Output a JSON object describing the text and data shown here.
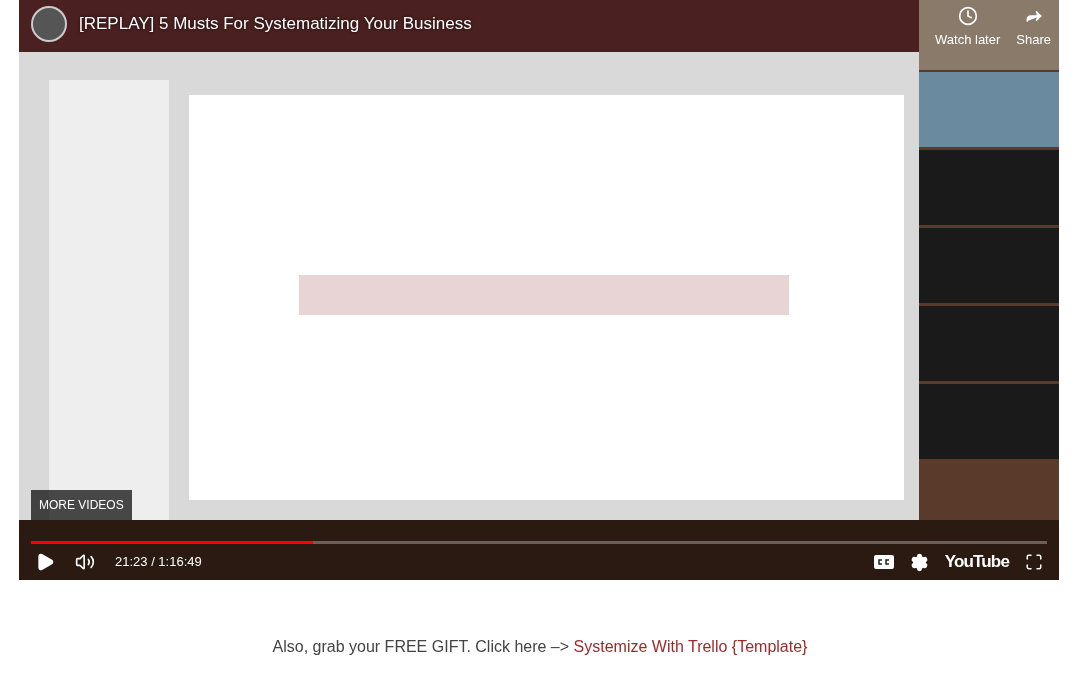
{
  "player": {
    "kind": "picture",
    "title": "[REPLAY] 5 Musts For Systematizing Your Business",
    "actions": [
      {
        "kind": "clock",
        "label": "Watch later"
      },
      {
        "kind": "share",
        "label": "Share"
      }
    ],
    "more_videos": "MORE VIDEOS",
    "progress": {
      "level": 0.278
    },
    "time": "21:23 / 1:16:49",
    "logo": "YouTube"
  },
  "caption": {
    "text": "Also, grab your FREE GIFT. Click here –> ",
    "link": "Systemize With Trello {Template}"
  }
}
